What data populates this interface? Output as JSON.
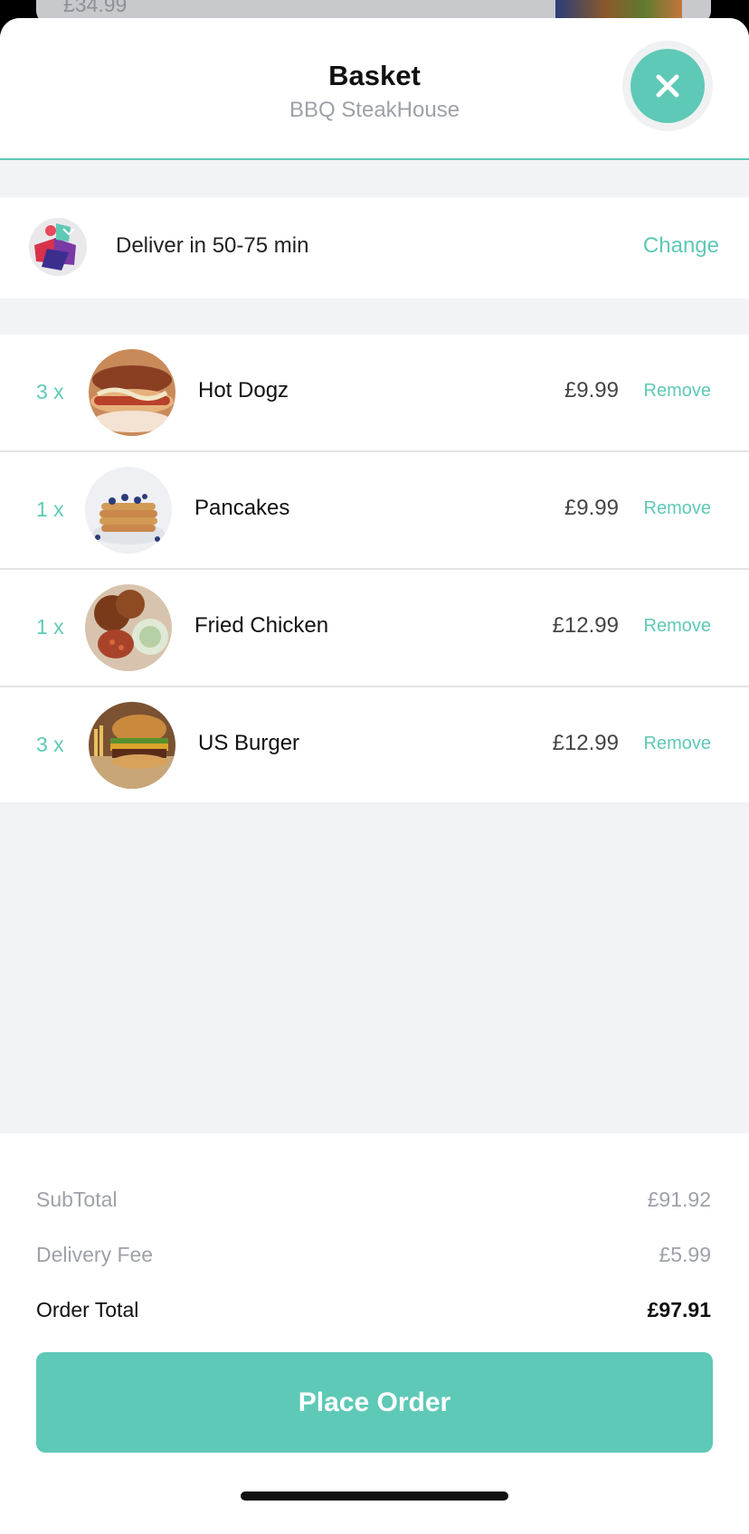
{
  "background_peek": {
    "price": "£34.99"
  },
  "header": {
    "title": "Basket",
    "subtitle": "BBQ SteakHouse"
  },
  "delivery": {
    "text": "Deliver in 50-75 min",
    "change_label": "Change"
  },
  "items": [
    {
      "qty": "3 x",
      "name": "Hot Dogz",
      "price": "£9.99",
      "remove_label": "Remove"
    },
    {
      "qty": "1 x",
      "name": "Pancakes",
      "price": "£9.99",
      "remove_label": "Remove"
    },
    {
      "qty": "1 x",
      "name": "Fried Chicken",
      "price": "£12.99",
      "remove_label": "Remove"
    },
    {
      "qty": "3 x",
      "name": "US Burger",
      "price": "£12.99",
      "remove_label": "Remove"
    }
  ],
  "totals": {
    "subtotal_label": "SubTotal",
    "subtotal_value": "£91.92",
    "delivery_fee_label": "Delivery Fee",
    "delivery_fee_value": "£5.99",
    "order_total_label": "Order Total",
    "order_total_value": "£97.91"
  },
  "place_order_label": "Place Order",
  "colors": {
    "accent": "#5ec9b6",
    "muted": "#9ea1a8",
    "background": "#f2f3f5"
  },
  "icons": {
    "close": "close-icon",
    "delivery": "delivery-avatar-icon"
  }
}
